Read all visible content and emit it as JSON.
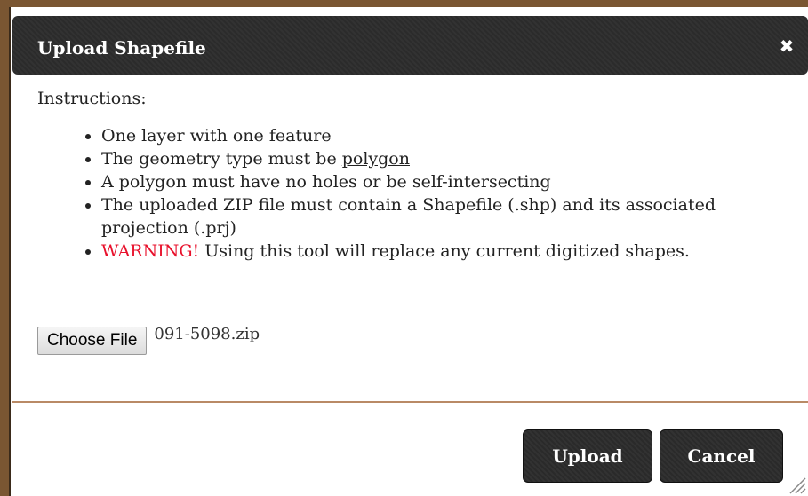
{
  "dialog": {
    "title": "Upload Shapefile",
    "close_icon": "close-icon",
    "close_glyph": "✖"
  },
  "instructions": {
    "heading": "Instructions:",
    "items": [
      {
        "text": "One layer with one feature"
      },
      {
        "prefix": "The geometry type must be ",
        "emphasis": "polygon"
      },
      {
        "text": "A polygon must have no holes or be self-intersecting"
      },
      {
        "text": "The uploaded ZIP file must contain a Shapefile (.shp) and its associated projection (.prj)"
      },
      {
        "warning": "WARNING!",
        "text": " Using this tool will replace any current digitized shapes."
      }
    ]
  },
  "file_input": {
    "button_label": "Choose File",
    "file_name": "091-5098.zip"
  },
  "footer": {
    "upload_label": "Upload",
    "cancel_label": "Cancel"
  },
  "colors": {
    "titlebar": "#2b2b2b",
    "warning": "#e8102b",
    "divider": "#b98a66",
    "backdrop": "#7a5632"
  }
}
